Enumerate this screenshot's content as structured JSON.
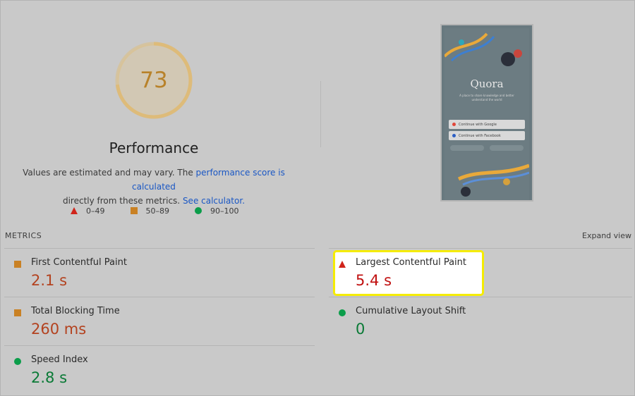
{
  "summary": {
    "score": "73",
    "score_fraction": 0.73,
    "category_title": "Performance",
    "description_prefix": "Values are estimated and may vary. The ",
    "description_link1": "performance score is calculated",
    "description_middle": " directly from these metrics. ",
    "description_link2": "See calculator.",
    "legend": [
      {
        "icon": "red-triangle-icon",
        "label": "0–49"
      },
      {
        "icon": "orange-square-icon",
        "label": "50–89"
      },
      {
        "icon": "green-circle-icon",
        "label": "90–100"
      }
    ]
  },
  "screenshot": {
    "site_name": "Quora",
    "tagline": "A place to share knowledge and better understand the world",
    "button_google": "Continue with Google",
    "button_facebook": "Continue with Facebook"
  },
  "metrics": {
    "section_label": "METRICS",
    "expand_label": "Expand view",
    "items": [
      {
        "name": "First Contentful Paint",
        "value": "2.1 s",
        "rating": "average"
      },
      {
        "name": "Largest Contentful Paint",
        "value": "5.4 s",
        "rating": "fail"
      },
      {
        "name": "Total Blocking Time",
        "value": "260 ms",
        "rating": "average"
      },
      {
        "name": "Cumulative Layout Shift",
        "value": "0",
        "rating": "pass"
      },
      {
        "name": "Speed Index",
        "value": "2.8 s",
        "rating": "pass"
      }
    ]
  },
  "colors": {
    "fail": "#d0241a",
    "average": "#c98124",
    "pass": "#0b9d4a",
    "highlight_border": "#f5ec00"
  }
}
